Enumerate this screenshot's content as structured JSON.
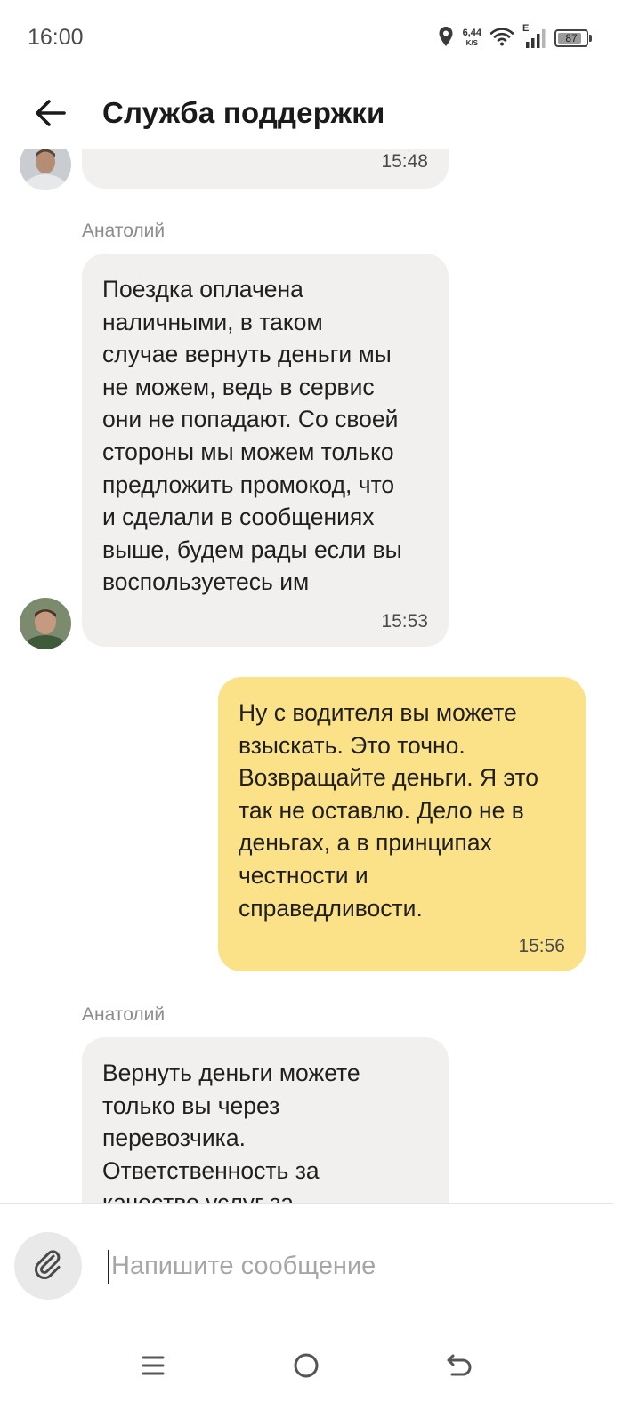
{
  "status_bar": {
    "time": "16:00",
    "net_speed_value": "6,44",
    "net_speed_unit": "K/S",
    "network_type": "E",
    "battery_level": "87",
    "battery_fraction": 0.87
  },
  "header": {
    "title": "Служба поддержки"
  },
  "messages": [
    {
      "direction": "incoming",
      "sender": "",
      "text": "",
      "time": "15:48"
    },
    {
      "direction": "incoming",
      "sender": "Анатолий",
      "text": "Поездка оплачена\nналичными, в таком\nслучае вернуть деньги мы\nне можем, ведь в сервис\nони не попадают. Со своей\nстороны мы можем только\nпредложить промокод, что\nи сделали в сообщениях\nвыше, будем рады если вы\nвоспользуетесь им",
      "time": "15:53"
    },
    {
      "direction": "outgoing",
      "text": "Ну с водителя вы можете\nвзыскать. Это точно.\nВозвращайте деньги. Я это\nтак не оставлю. Дело не в\nденьгах, а в принципах\nчестности и\nсправедливости.",
      "time": "15:56"
    },
    {
      "direction": "incoming",
      "sender": "Анатолий",
      "text": "Вернуть деньги можете\nтолько вы через\nперевозчика.\nОтветственность за\nкачество услуг за",
      "time": ""
    }
  ],
  "composer": {
    "placeholder": "Напишите сообщение",
    "value": ""
  },
  "icons": {
    "back": "arrow-left-icon",
    "location": "location-pin-icon",
    "wifi": "wifi-icon",
    "signal": "signal-bars-icon",
    "battery": "battery-icon",
    "attach": "paperclip-icon",
    "menu": "menu-icon",
    "home": "home-circle-icon",
    "back_nav": "return-arrow-icon"
  },
  "colors": {
    "incoming_bubble": "#f1f0ee",
    "outgoing_bubble": "#fbe288",
    "secondary_text": "#8c8c8c"
  }
}
